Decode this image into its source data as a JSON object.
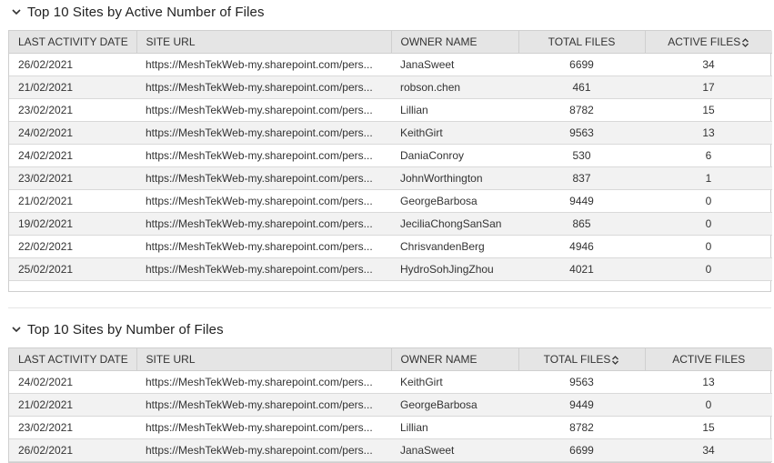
{
  "sections": [
    {
      "title": "Top 10 Sites by Active Number of Files",
      "columns": [
        "LAST ACTIVITY DATE",
        "SITE URL",
        "OWNER NAME",
        "TOTAL FILES",
        "ACTIVE FILES"
      ],
      "sorted_column": 4,
      "rows": [
        [
          "26/02/2021",
          "https://MeshTekWeb-my.sharepoint.com/pers...",
          "JanaSweet",
          "6699",
          "34"
        ],
        [
          "21/02/2021",
          "https://MeshTekWeb-my.sharepoint.com/pers...",
          "robson.chen",
          "461",
          "17"
        ],
        [
          "23/02/2021",
          "https://MeshTekWeb-my.sharepoint.com/pers...",
          "Lillian",
          "8782",
          "15"
        ],
        [
          "24/02/2021",
          "https://MeshTekWeb-my.sharepoint.com/pers...",
          "KeithGirt",
          "9563",
          "13"
        ],
        [
          "24/02/2021",
          "https://MeshTekWeb-my.sharepoint.com/pers...",
          "DaniaConroy",
          "530",
          "6"
        ],
        [
          "23/02/2021",
          "https://MeshTekWeb-my.sharepoint.com/pers...",
          "JohnWorthington",
          "837",
          "1"
        ],
        [
          "21/02/2021",
          "https://MeshTekWeb-my.sharepoint.com/pers...",
          "GeorgeBarbosa",
          "9449",
          "0"
        ],
        [
          "19/02/2021",
          "https://MeshTekWeb-my.sharepoint.com/pers...",
          "JeciliaChongSanSan",
          "865",
          "0"
        ],
        [
          "22/02/2021",
          "https://MeshTekWeb-my.sharepoint.com/pers...",
          "ChrisvandenBerg",
          "4946",
          "0"
        ],
        [
          "25/02/2021",
          "https://MeshTekWeb-my.sharepoint.com/pers...",
          "HydroSohJingZhou",
          "4021",
          "0"
        ]
      ]
    },
    {
      "title": "Top 10 Sites by Number of Files",
      "columns": [
        "LAST ACTIVITY DATE",
        "SITE URL",
        "OWNER NAME",
        "TOTAL FILES",
        "ACTIVE FILES"
      ],
      "sorted_column": 3,
      "rows": [
        [
          "24/02/2021",
          "https://MeshTekWeb-my.sharepoint.com/pers...",
          "KeithGirt",
          "9563",
          "13"
        ],
        [
          "21/02/2021",
          "https://MeshTekWeb-my.sharepoint.com/pers...",
          "GeorgeBarbosa",
          "9449",
          "0"
        ],
        [
          "23/02/2021",
          "https://MeshTekWeb-my.sharepoint.com/pers...",
          "Lillian",
          "8782",
          "15"
        ],
        [
          "26/02/2021",
          "https://MeshTekWeb-my.sharepoint.com/pers...",
          "JanaSweet",
          "6699",
          "34"
        ]
      ]
    }
  ],
  "icons": {
    "collapse": "chevron-down-icon",
    "sort": "sort-toggle-icon"
  }
}
